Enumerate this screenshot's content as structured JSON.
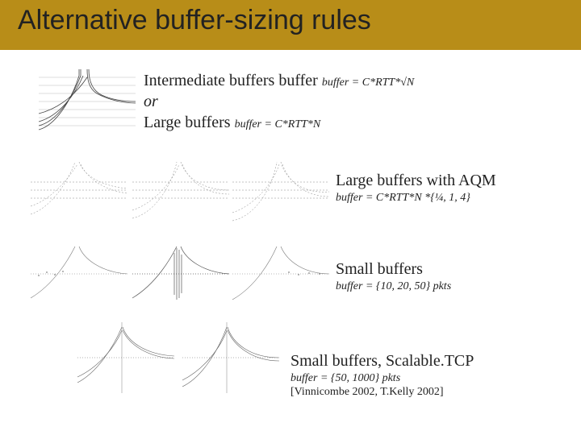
{
  "title": "Alternative buffer-sizing rules",
  "sections": {
    "inter_large": {
      "intermediate_main": "Intermediate buffers buffer",
      "intermediate_formula": "buffer = C*RTT*√N",
      "or": "or",
      "large_main": "Large buffers",
      "large_formula": "buffer = C*RTT*N"
    },
    "aqm": {
      "main": "Large buffers with AQM",
      "formula": "buffer = C*RTT*N *{¼, 1, 4}"
    },
    "small": {
      "main": "Small buffers",
      "formula": "buffer = {10, 20, 50} pkts"
    },
    "scalable": {
      "main": "Small buffers, Scalable.TCP",
      "formula": "buffer = {50, 1000} pkts",
      "cite": "[Vinnicombe 2002, T.Kelly 2002]"
    }
  },
  "chart_data": [
    {
      "type": "line",
      "title": "intermediate-large",
      "note": "multiple TCP throughput trajectories converging",
      "xlabel": "",
      "ylabel": "",
      "series": []
    },
    {
      "type": "line",
      "title": "aqm-1",
      "note": "trajectories scale ¼",
      "series": []
    },
    {
      "type": "line",
      "title": "aqm-2",
      "note": "trajectories scale 1",
      "series": []
    },
    {
      "type": "line",
      "title": "aqm-3",
      "note": "trajectories scale 4",
      "series": []
    },
    {
      "type": "line",
      "title": "small-1",
      "note": "buffer 10 pkts",
      "series": []
    },
    {
      "type": "line",
      "title": "small-2",
      "note": "buffer 20 pkts",
      "series": []
    },
    {
      "type": "line",
      "title": "small-3",
      "note": "buffer 50 pkts",
      "series": []
    },
    {
      "type": "line",
      "title": "scalable-1",
      "note": "buffer 50 pkts",
      "series": []
    },
    {
      "type": "line",
      "title": "scalable-2",
      "note": "buffer 1000 pkts",
      "series": []
    }
  ]
}
